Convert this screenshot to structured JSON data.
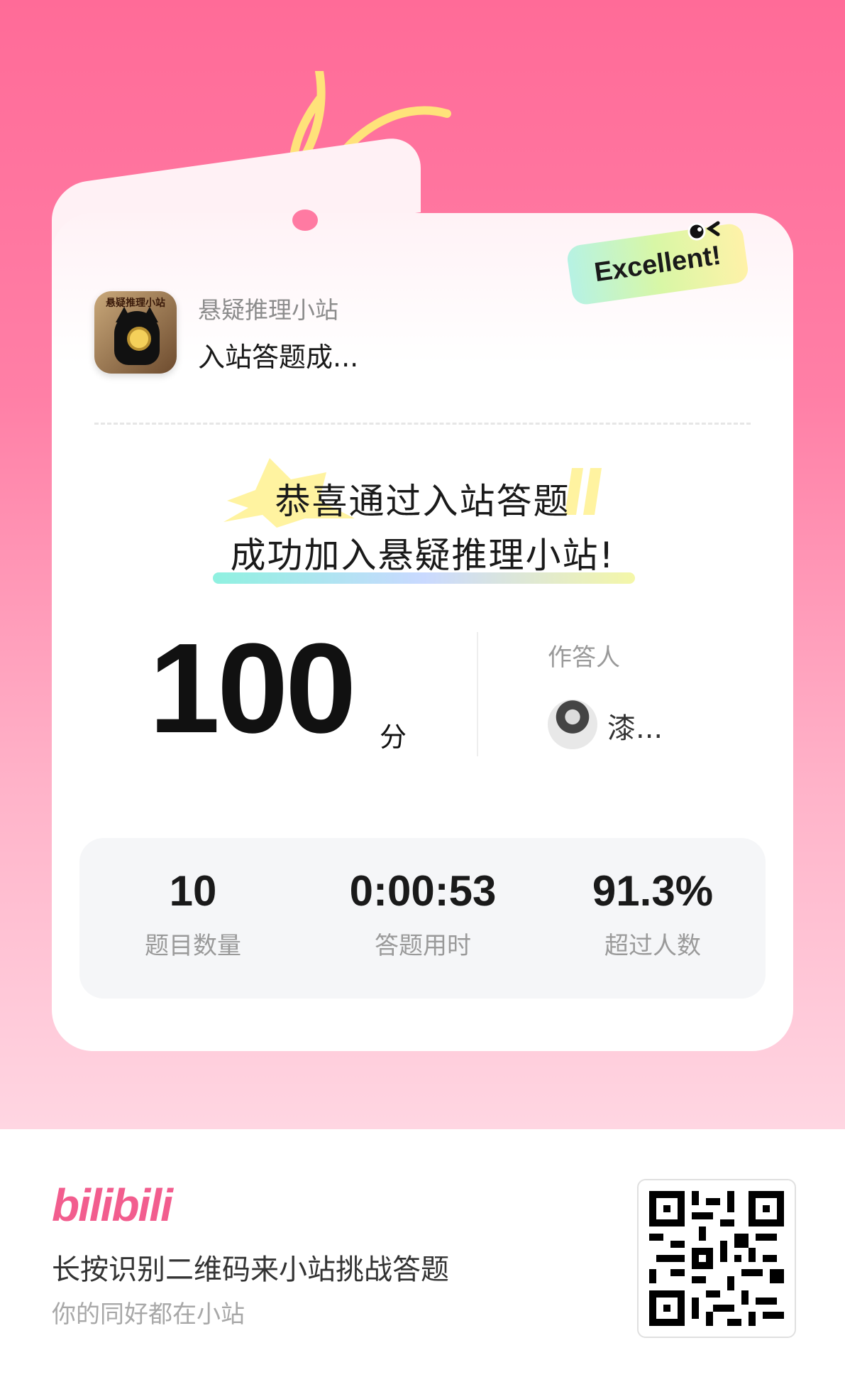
{
  "app": {
    "title": "悬疑推理小站",
    "subtitle": "入站答题成...",
    "icon_text": "悬疑推理小站"
  },
  "badge": {
    "label": "Excellent!"
  },
  "congrats": {
    "line1": "恭喜通过入站答题",
    "line2": "成功加入悬疑推理小站!"
  },
  "score": {
    "value": "100",
    "unit": "分"
  },
  "answerer": {
    "label": "作答人",
    "name": "漆..."
  },
  "stats": [
    {
      "value": "10",
      "label": "题目数量"
    },
    {
      "value": "0:00:53",
      "label": "答题用时"
    },
    {
      "value": "91.3%",
      "label": "超过人数"
    }
  ],
  "footer": {
    "logo": "bilibili",
    "main_text": "长按识别二维码来小站挑战答题",
    "sub_text": "你的同好都在小站"
  },
  "colors": {
    "brand_pink": "#f25d8e",
    "bg_gradient_top": "#ff6b98",
    "string_yellow": "#ffe27a"
  },
  "icons": [
    "tag-string-icon",
    "app-cat-icon",
    "qr-code-icon",
    "avatar-icon"
  ]
}
